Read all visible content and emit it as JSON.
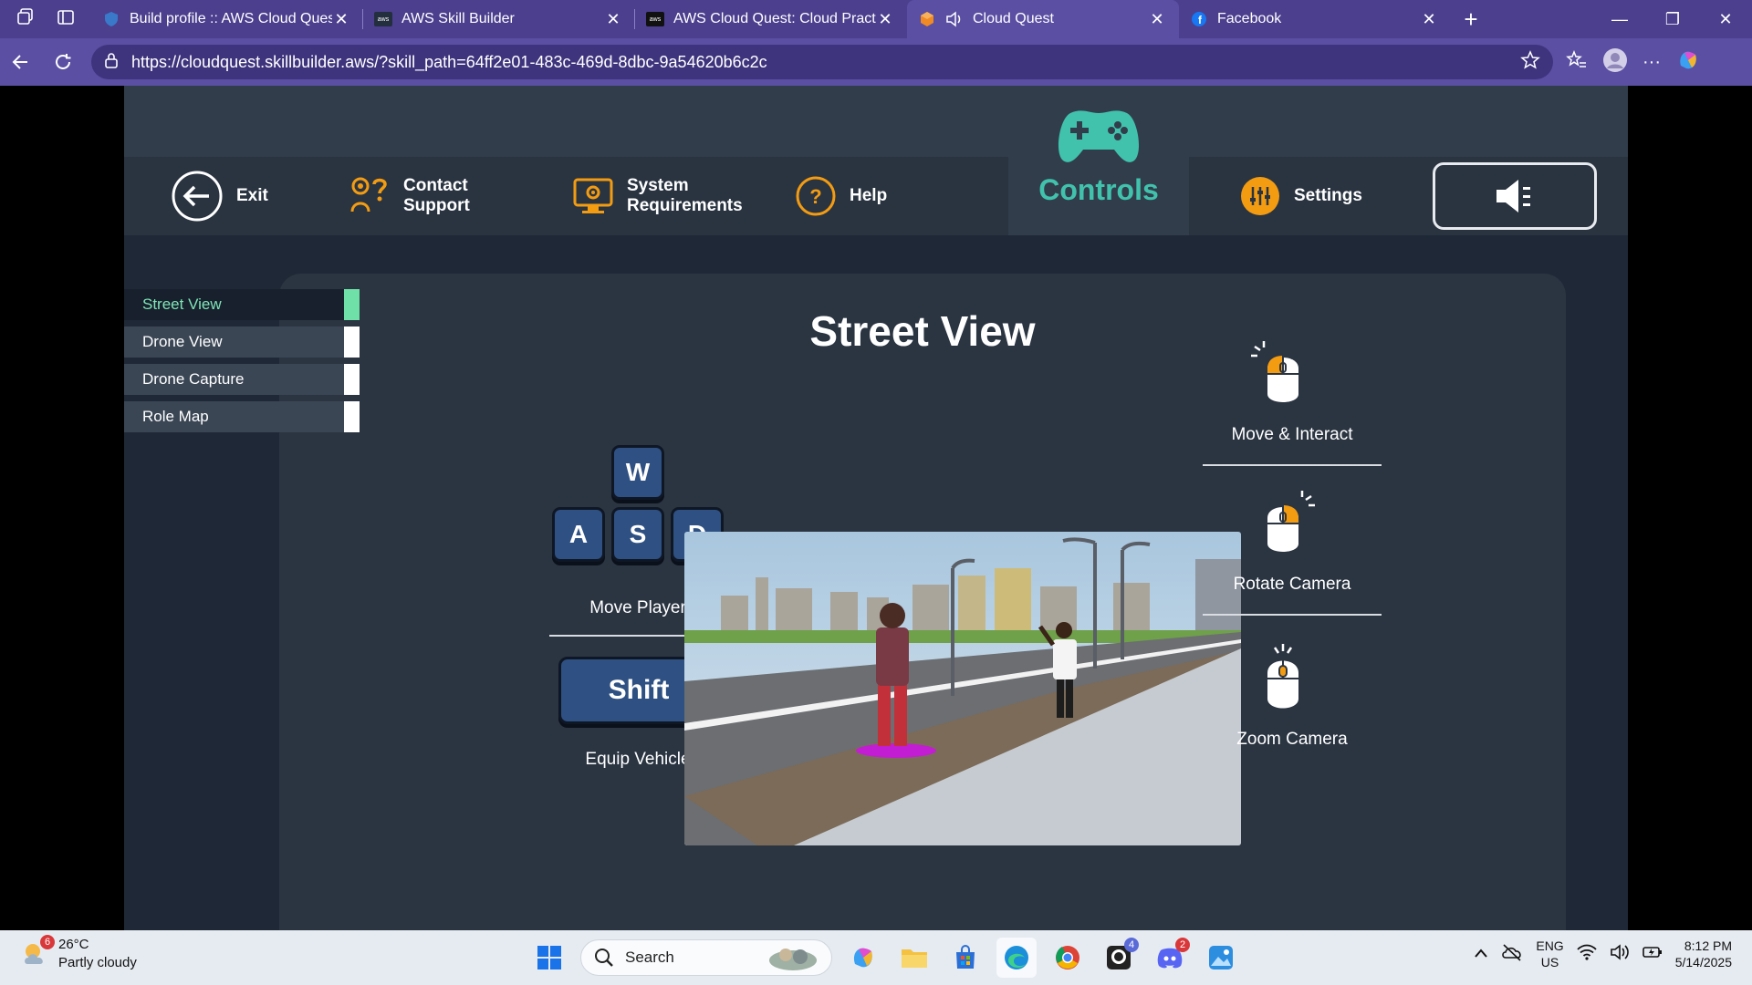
{
  "browser": {
    "tabs": [
      {
        "title": "Build profile :: AWS Cloud Quest: C",
        "icon": "aws-shield-icon"
      },
      {
        "title": "AWS Skill Builder",
        "icon": "aws-icon"
      },
      {
        "title": "AWS Cloud Quest: Cloud Practitio",
        "icon": "aws-icon"
      },
      {
        "title": "Cloud Quest",
        "icon": "cloud-quest-icon",
        "active": true
      },
      {
        "title": "Facebook",
        "icon": "facebook-icon"
      }
    ],
    "url": "https://cloudquest.skillbuilder.aws/?skill_path=64ff2e01-483c-469d-8dbc-9a54620b6c2c"
  },
  "game": {
    "menu": {
      "exit": "Exit",
      "contact_support": "Contact Support",
      "system_requirements": "System Requirements",
      "help": "Help",
      "controls": "Controls",
      "settings": "Settings"
    },
    "side_list": [
      {
        "label": "Street View",
        "active": true
      },
      {
        "label": "Drone View"
      },
      {
        "label": "Drone Capture"
      },
      {
        "label": "Role Map"
      }
    ],
    "panel": {
      "title": "Street View",
      "keys": {
        "w": "W",
        "a": "A",
        "s": "S",
        "d": "D",
        "shift": "Shift"
      },
      "move_player": "Move Player",
      "equip_vehicle": "Equip Vehicle",
      "move_interact": "Move & Interact",
      "rotate_camera": "Rotate Camera",
      "zoom_camera": "Zoom Camera"
    },
    "colors": {
      "accent": "#41c2ad",
      "key_blue": "#2e5082",
      "orange": "#f39c12",
      "active_indicator": "#6fe0a8"
    }
  },
  "taskbar": {
    "weather": {
      "badge": "6",
      "temp": "26°C",
      "condition": "Partly cloudy"
    },
    "search_label": "Search",
    "github_badge": "4",
    "discord_badge": "2",
    "lang": "ENG",
    "region": "US",
    "time": "8:12 PM",
    "date": "5/14/2025"
  }
}
